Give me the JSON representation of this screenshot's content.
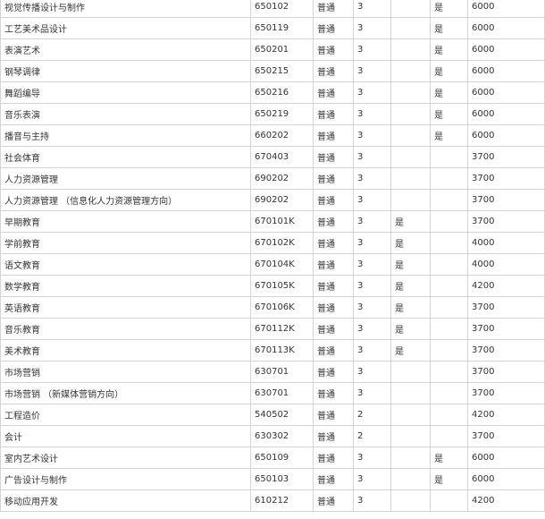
{
  "rows": [
    [
      "视觉传播设计与制作",
      "650102",
      "普通",
      "3",
      "",
      "是",
      "6000"
    ],
    [
      "工艺美术品设计",
      "650119",
      "普通",
      "3",
      "",
      "是",
      "6000"
    ],
    [
      "表演艺术",
      "650201",
      "普通",
      "3",
      "",
      "是",
      "6000"
    ],
    [
      "钢琴调律",
      "650215",
      "普通",
      "3",
      "",
      "是",
      "6000"
    ],
    [
      "舞蹈编导",
      "650216",
      "普通",
      "3",
      "",
      "是",
      "6000"
    ],
    [
      "音乐表演",
      "650219",
      "普通",
      "3",
      "",
      "是",
      "6000"
    ],
    [
      "播音与主持",
      "660202",
      "普通",
      "3",
      "",
      "是",
      "6000"
    ],
    [
      "社会体育",
      "670403",
      "普通",
      "3",
      "",
      "",
      "3700"
    ],
    [
      "人力资源管理",
      "690202",
      "普通",
      "3",
      "",
      "",
      "3700"
    ],
    [
      "人力资源管理 （信息化人力资源管理方向）",
      "690202",
      "普通",
      "3",
      "",
      "",
      "3700"
    ],
    [
      "早期教育",
      "670101K",
      "普通",
      "3",
      "是",
      "",
      "3700"
    ],
    [
      "学前教育",
      "670102K",
      "普通",
      "3",
      "是",
      "",
      "4000"
    ],
    [
      "语文教育",
      "670104K",
      "普通",
      "3",
      "是",
      "",
      "4000"
    ],
    [
      "数学教育",
      "670105K",
      "普通",
      "3",
      "是",
      "",
      "4200"
    ],
    [
      "英语教育",
      "670106K",
      "普通",
      "3",
      "是",
      "",
      "3700"
    ],
    [
      "音乐教育",
      "670112K",
      "普通",
      "3",
      "是",
      "",
      "3700"
    ],
    [
      "美术教育",
      "670113K",
      "普通",
      "3",
      "是",
      "",
      "3700"
    ],
    [
      "市场营销",
      "630701",
      "普通",
      "3",
      "",
      "",
      "3700"
    ],
    [
      "市场营销 （新媒体营销方向）",
      "630701",
      "普通",
      "3",
      "",
      "",
      "3700"
    ],
    [
      "工程造价",
      "540502",
      "普通",
      "2",
      "",
      "",
      "4200"
    ],
    [
      "会计",
      "630302",
      "普通",
      "2",
      "",
      "",
      "3700"
    ],
    [
      "室内艺术设计",
      "650109",
      "普通",
      "3",
      "",
      "是",
      "6000"
    ],
    [
      "广告设计与制作",
      "650103",
      "普通",
      "3",
      "",
      "是",
      "6000"
    ],
    [
      "移动应用开发",
      "610212",
      "普通",
      "3",
      "",
      "",
      "4200"
    ]
  ]
}
